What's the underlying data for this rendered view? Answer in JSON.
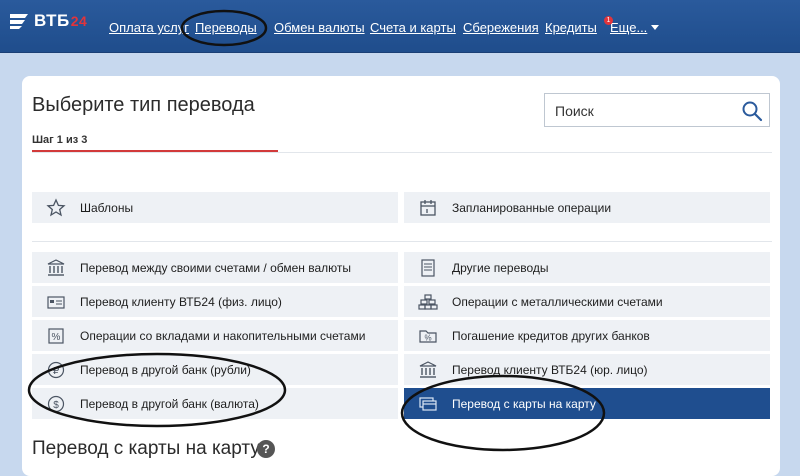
{
  "brand": {
    "name": "ВТБ",
    "suffix": "24"
  },
  "nav": {
    "items": [
      {
        "label": "Оплата услуг"
      },
      {
        "label": "Переводы"
      },
      {
        "label": "Обмен валюты"
      },
      {
        "label": "Счета и карты"
      },
      {
        "label": "Сбережения"
      },
      {
        "label": "Кредиты"
      },
      {
        "label": "Еще..."
      }
    ],
    "badge": "1"
  },
  "page": {
    "title": "Выберите тип перевода",
    "step": "Шаг 1 из 3",
    "search_placeholder": "Поиск",
    "bottom_title": "Перевод с карты на карту",
    "help": "?"
  },
  "quick": [
    {
      "label": "Шаблоны",
      "icon": "star-icon"
    },
    {
      "label": "Запланированные операции",
      "icon": "calendar-icon"
    }
  ],
  "options_left": [
    {
      "label": "Перевод между своими счетами / обмен валюты",
      "icon": "bank-icon"
    },
    {
      "label": "Перевод клиенту ВТБ24 (физ. лицо)",
      "icon": "card-person-icon"
    },
    {
      "label": "Операции со вкладами и накопительными счетами",
      "icon": "deposit-icon"
    },
    {
      "label": "Перевод в другой банк (рубли)",
      "icon": "ruble-coin-icon"
    },
    {
      "label": "Перевод в другой банк (валюта)",
      "icon": "dollar-coin-icon"
    }
  ],
  "options_right": [
    {
      "label": "Другие переводы",
      "icon": "document-icon"
    },
    {
      "label": "Операции с металлическими счетами",
      "icon": "gold-bars-icon"
    },
    {
      "label": "Погашение кредитов других банков",
      "icon": "percent-folder-icon"
    },
    {
      "label": "Перевод клиенту ВТБ24 (юр. лицо)",
      "icon": "bank-icon"
    },
    {
      "label": "Перевод с карты на карту",
      "icon": "cards-icon",
      "selected": true
    }
  ],
  "colors": {
    "nav_bg": "#1f4d8c",
    "selected_bg": "#1f4e8f",
    "step_accent": "#d23a3a",
    "badge": "#e2343b"
  }
}
